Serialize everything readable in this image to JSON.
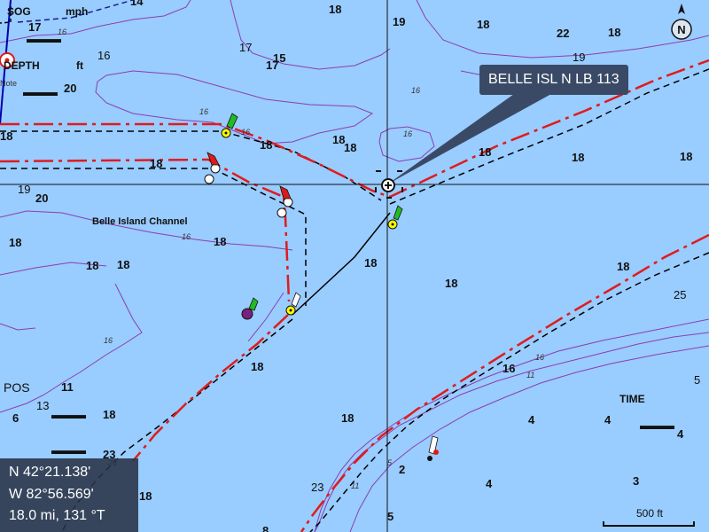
{
  "hud": {
    "sog_label": "SOG",
    "sog_unit": "mph",
    "depth_label": "DEPTH",
    "depth_unit": "ft",
    "note_label": "Note",
    "pos_label": "POS",
    "time_label": "TIME",
    "placeholder": "▬▬▬"
  },
  "tooltip": {
    "text": "BELLE ISL N LB 113"
  },
  "position": {
    "lat": "N  42°21.138'",
    "lon": "W  82°56.569'",
    "range_bearing": "18.0 mi, 131 °T"
  },
  "scale": {
    "label": "500 ft"
  },
  "compass": {
    "label": "N"
  },
  "channel_label": "Belle Island Channel",
  "colors": {
    "water": "#99ccff",
    "route_red": "#e01b1b",
    "route_black": "#000000",
    "contour": "#8a3fb0",
    "buoy_green": "#22bb22",
    "buoy_red": "#dd1a1a",
    "tooltip_bg": "#3a4a66"
  },
  "soundings": [
    {
      "t": "14"
    },
    {
      "t": "17"
    },
    {
      "t": "20"
    },
    {
      "t": "18"
    },
    {
      "t": "19"
    },
    {
      "t": "18"
    },
    {
      "t": "22"
    },
    {
      "t": "18"
    },
    {
      "t": "19"
    },
    {
      "t": "16"
    },
    {
      "t": "17"
    },
    {
      "t": "17"
    },
    {
      "t": "15"
    },
    {
      "t": "18"
    },
    {
      "t": "18"
    },
    {
      "t": "18"
    },
    {
      "t": "18"
    },
    {
      "t": "18"
    },
    {
      "t": "18"
    },
    {
      "t": "18"
    },
    {
      "t": "19"
    },
    {
      "t": "20"
    },
    {
      "t": "18"
    },
    {
      "t": "18"
    },
    {
      "t": "18"
    },
    {
      "t": "18"
    },
    {
      "t": "18"
    },
    {
      "t": "18"
    },
    {
      "t": "18"
    },
    {
      "t": "18"
    },
    {
      "t": "25"
    },
    {
      "t": "18"
    },
    {
      "t": "16"
    },
    {
      "t": "11"
    },
    {
      "t": "13"
    },
    {
      "t": "6"
    },
    {
      "t": "18"
    },
    {
      "t": "18"
    },
    {
      "t": "4"
    },
    {
      "t": "4"
    },
    {
      "t": "5"
    },
    {
      "t": "4"
    },
    {
      "t": "23"
    },
    {
      "t": "2"
    },
    {
      "t": "4"
    },
    {
      "t": "3"
    },
    {
      "t": "18"
    },
    {
      "t": "23"
    },
    {
      "t": "5"
    },
    {
      "t": "8"
    }
  ],
  "contour_labels": [
    {
      "t": "16"
    },
    {
      "t": "16"
    },
    {
      "t": "16"
    },
    {
      "t": "16"
    },
    {
      "t": "16"
    },
    {
      "t": "16"
    },
    {
      "t": "16"
    },
    {
      "t": "16"
    },
    {
      "t": "11"
    },
    {
      "t": "11"
    },
    {
      "t": "5"
    },
    {
      "t": "26"
    }
  ]
}
